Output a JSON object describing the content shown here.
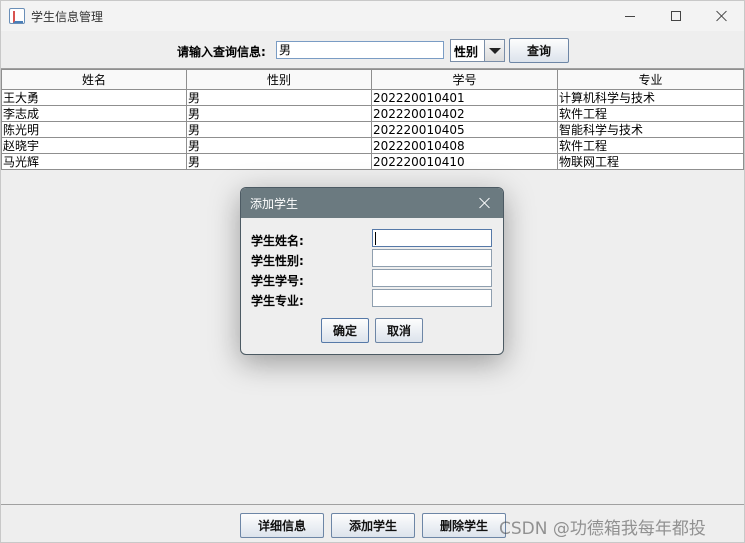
{
  "window": {
    "title": "学生信息管理",
    "icon": "java-app-icon"
  },
  "search": {
    "label": "请输入查询信息:",
    "value": "男",
    "field_selected": "性别",
    "query_button": "查询"
  },
  "table": {
    "headers": [
      "姓名",
      "性别",
      "学号",
      "专业"
    ],
    "rows": [
      [
        "王大勇",
        "男",
        "202220010401",
        "计算机科学与技术"
      ],
      [
        "李志成",
        "男",
        "202220010402",
        "软件工程"
      ],
      [
        "陈光明",
        "男",
        "202220010405",
        "智能科学与技术"
      ],
      [
        "赵晓宇",
        "男",
        "202220010408",
        "软件工程"
      ],
      [
        "马光辉",
        "男",
        "202220010410",
        "物联网工程"
      ]
    ]
  },
  "buttons": {
    "detail": "详细信息",
    "add": "添加学生",
    "delete": "删除学生"
  },
  "dialog": {
    "title": "添加学生",
    "fields": [
      {
        "label": "学生姓名:",
        "value": ""
      },
      {
        "label": "学生性别:",
        "value": ""
      },
      {
        "label": "学生学号:",
        "value": ""
      },
      {
        "label": "学生专业:",
        "value": ""
      }
    ],
    "ok": "确定",
    "cancel": "取消"
  },
  "watermark": "CSDN @功德箱我每年都投"
}
